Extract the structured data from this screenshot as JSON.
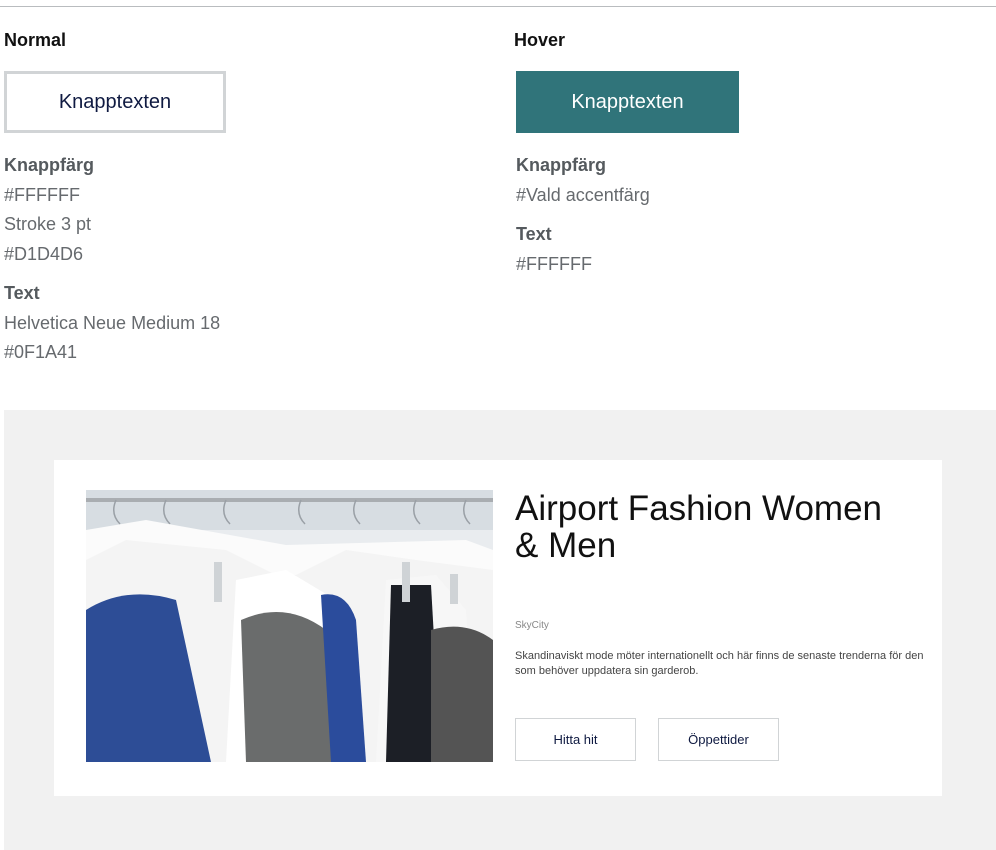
{
  "normal": {
    "heading": "Normal",
    "button_label": "Knapptexten",
    "button_label_title": "Knappfärg",
    "button_color": "#FFFFFF",
    "stroke": "Stroke 3 pt",
    "stroke_color": "#D1D4D6",
    "text_title": "Text",
    "text_font": "Helvetica Neue Medium 18",
    "text_color": "#0F1A41"
  },
  "hover": {
    "heading": "Hover",
    "button_label": "Knapptexten",
    "button_label_title": "Knappfärg",
    "button_color": "#Vald accentfärg",
    "text_title": "Text",
    "text_color": "#FFFFFF"
  },
  "colors": {
    "accent": "#30747a",
    "stroke": "#D1D4D6",
    "text_dark": "#0F1A41"
  },
  "card": {
    "title": "Airport Fashion Women & Men",
    "subtitle": "SkyCity",
    "description": "Skandinaviskt mode möter internationellt och här finns de senaste trenderna för den som behöver uppdatera sin garderob.",
    "button_directions": "Hitta hit",
    "button_hours": "Öppettider"
  }
}
